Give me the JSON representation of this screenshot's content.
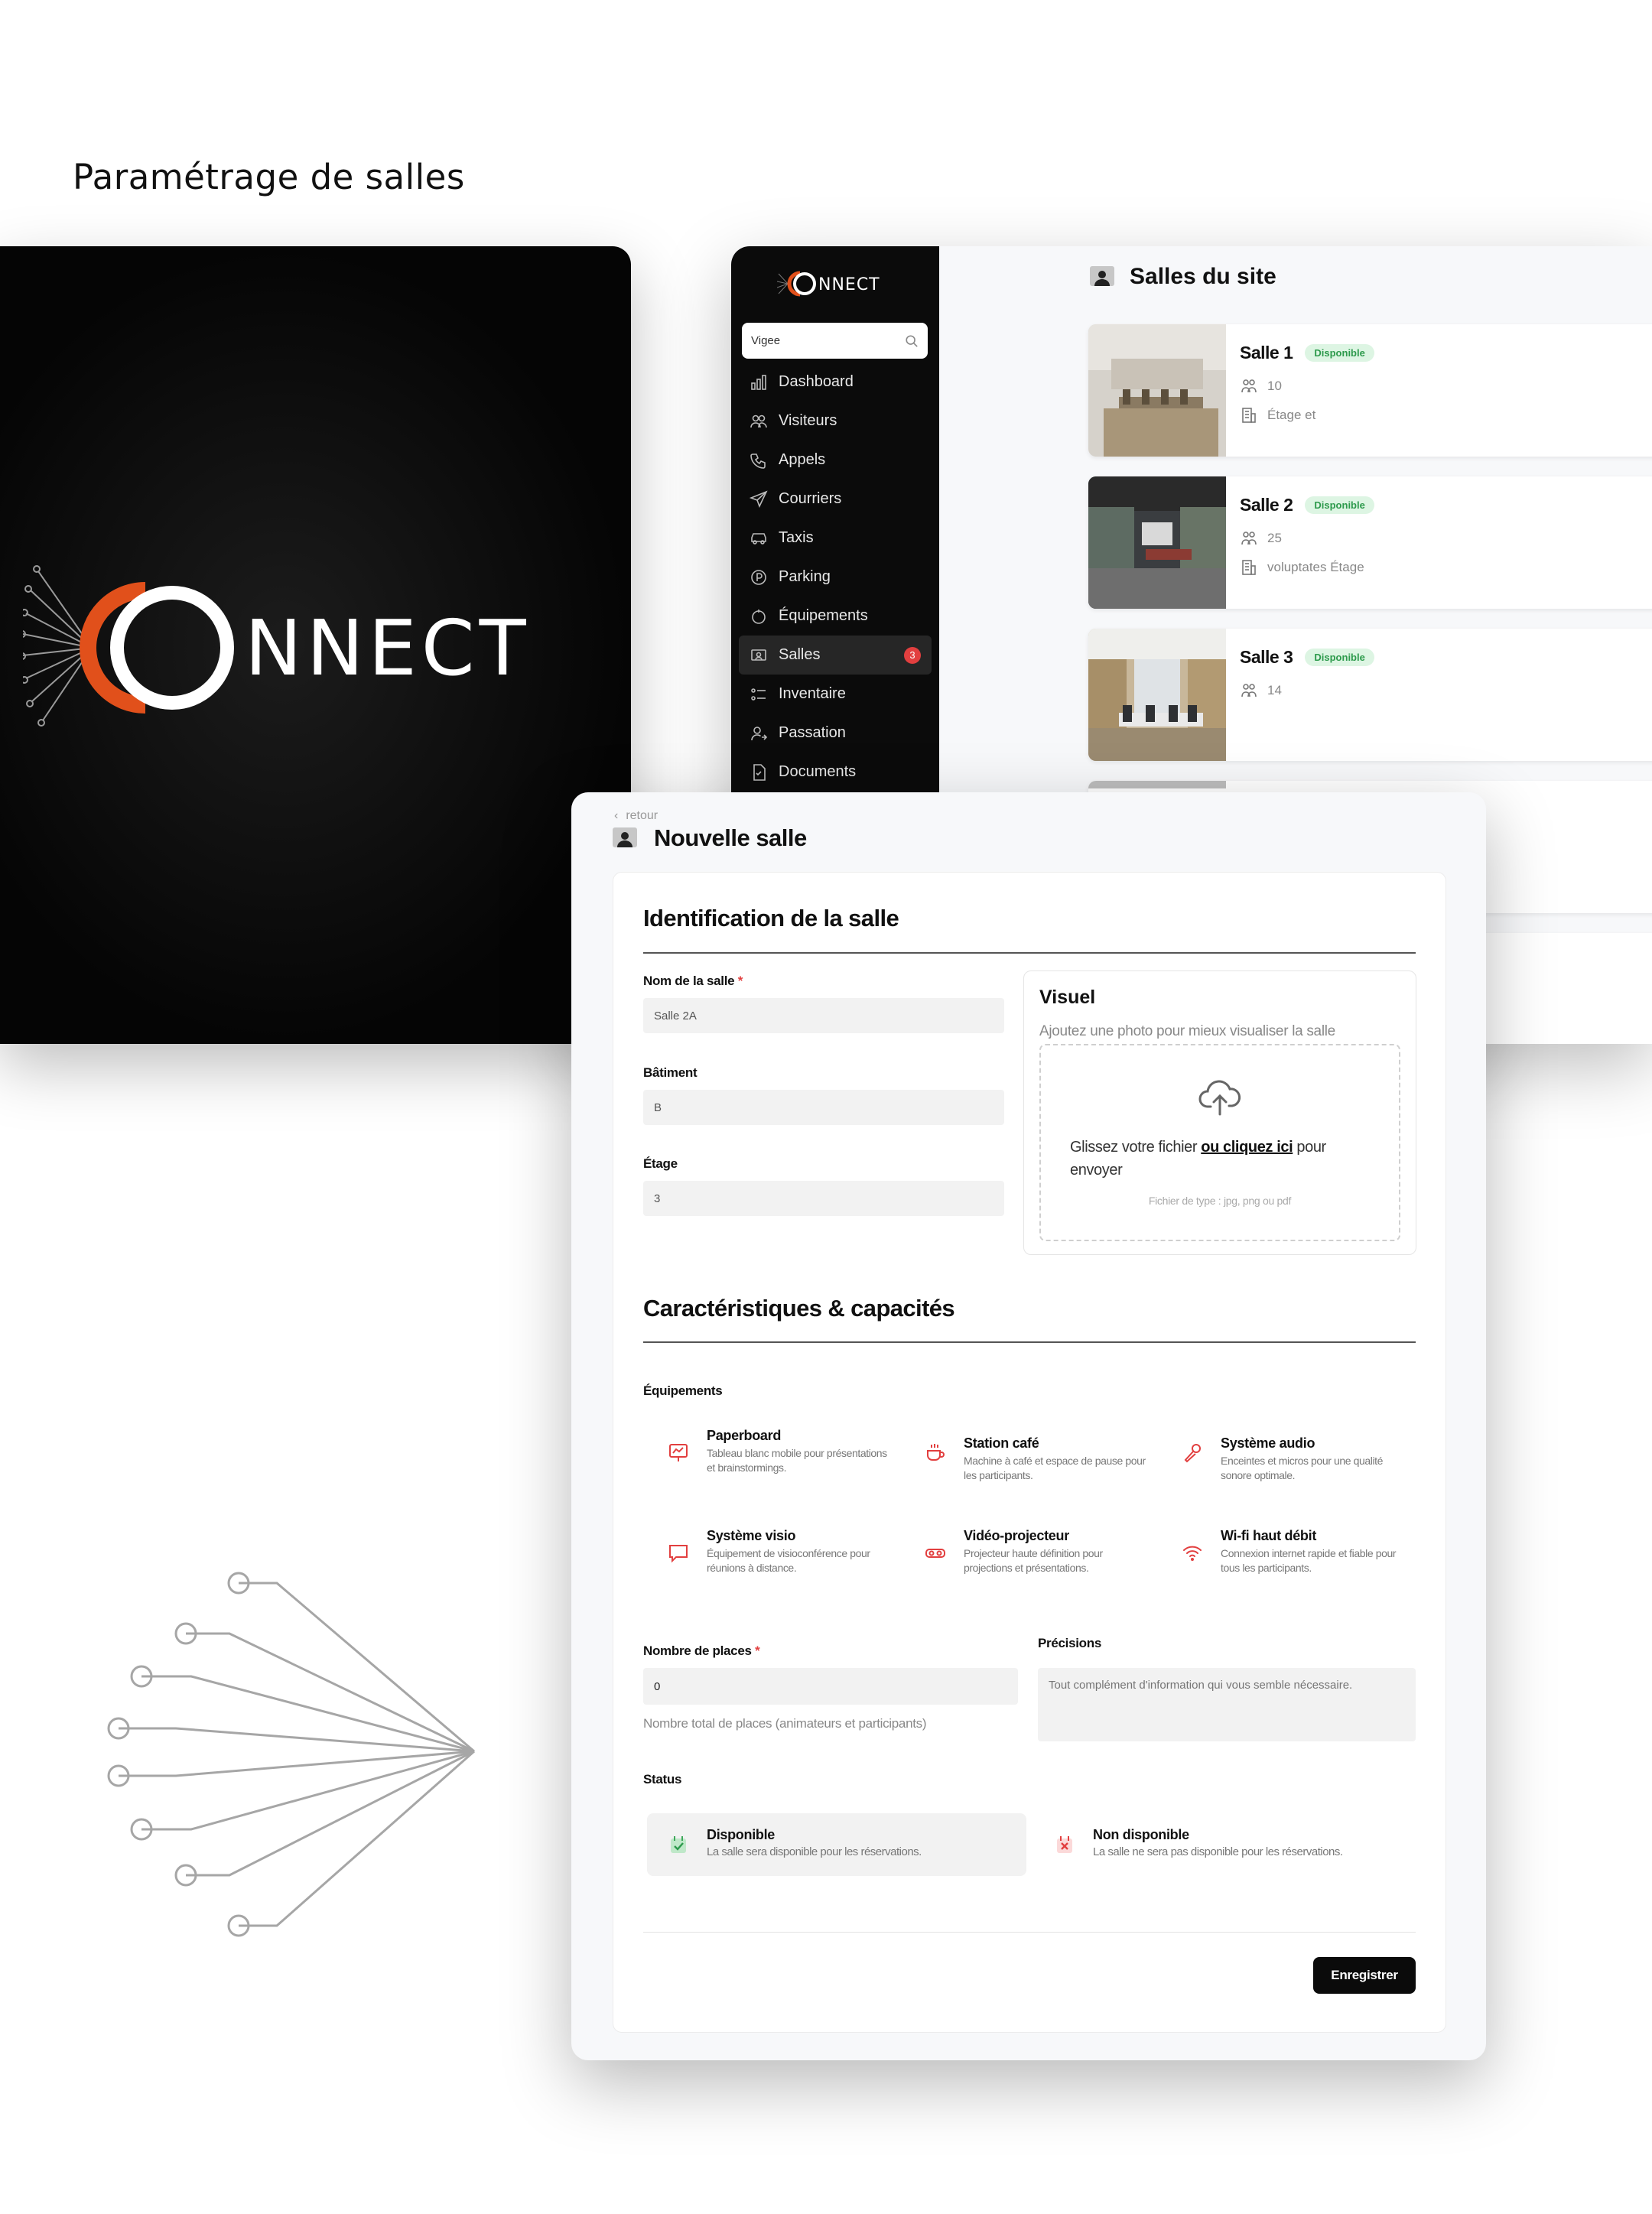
{
  "page": {
    "heading": "Paramétrage de salles"
  },
  "brand": {
    "logo_text": "NNECT",
    "accent": "#e1501b"
  },
  "sidebar": {
    "search": {
      "value": "Vigee"
    },
    "items": [
      {
        "label": "Dashboard",
        "icon": "chart-icon"
      },
      {
        "label": "Visiteurs",
        "icon": "users-icon"
      },
      {
        "label": "Appels",
        "icon": "phone-icon"
      },
      {
        "label": "Courriers",
        "icon": "send-icon"
      },
      {
        "label": "Taxis",
        "icon": "car-icon"
      },
      {
        "label": "Parking",
        "icon": "parking-icon"
      },
      {
        "label": "Équipements",
        "icon": "equipment-icon"
      },
      {
        "label": "Salles",
        "icon": "room-icon",
        "active": true,
        "badge": "3"
      },
      {
        "label": "Inventaire",
        "icon": "list-icon"
      },
      {
        "label": "Passation",
        "icon": "user-switch-icon"
      },
      {
        "label": "Documents",
        "icon": "document-icon"
      }
    ]
  },
  "salles": {
    "title": "Salles du site",
    "rooms": [
      {
        "name": "Salle 1",
        "status": "Disponible",
        "capacity": "10",
        "location": "Étage et"
      },
      {
        "name": "Salle 2",
        "status": "Disponible",
        "capacity": "25",
        "location": "voluptates Étage"
      },
      {
        "name": "Salle 3",
        "status": "Disponible",
        "capacity": "14",
        "location": ""
      }
    ]
  },
  "form": {
    "back": "retour",
    "title": "Nouvelle salle",
    "identification": {
      "title": "Identification de la salle",
      "name_label": "Nom de la salle",
      "name_value": "Salle 2A",
      "building_label": "Bâtiment",
      "building_value": "B",
      "floor_label": "Étage",
      "floor_value": "3"
    },
    "visual": {
      "title": "Visuel",
      "subtitle": "Ajoutez une photo pour mieux visualiser la salle",
      "drop_before": "Glissez votre fichier ",
      "drop_link": "ou cliquez ici",
      "drop_after": " pour envoyer",
      "hint": "Fichier de type : jpg, png ou pdf"
    },
    "characteristics": {
      "title": "Caractéristiques & capacités",
      "equipment_label": "Équipements",
      "equipments": [
        {
          "name": "Paperboard",
          "desc": "Tableau blanc mobile pour présentations et brainstormings."
        },
        {
          "name": "Station café",
          "desc": "Machine à café et espace de pause pour les participants."
        },
        {
          "name": "Système audio",
          "desc": "Enceintes et micros pour une qualité sonore optimale."
        },
        {
          "name": "Système visio",
          "desc": "Équipement de visioconférence pour réunions à distance."
        },
        {
          "name": "Vidéo-projecteur",
          "desc": "Projecteur haute définition pour projections et présentations."
        },
        {
          "name": "Wi-fi haut débit",
          "desc": "Connexion internet rapide et fiable pour tous les participants."
        }
      ],
      "places_label": "Nombre de places",
      "places_value": "0",
      "places_help": "Nombre total de places (animateurs et participants)",
      "precisions_label": "Précisions",
      "precisions_placeholder": "Tout complément d'information qui vous semble nécessaire."
    },
    "status": {
      "label": "Status",
      "options": [
        {
          "name": "Disponible",
          "desc": "La salle sera disponible pour les réservations.",
          "selected": true
        },
        {
          "name": "Non disponible",
          "desc": "La salle ne sera pas disponible pour les réservations.",
          "selected": false
        }
      ]
    },
    "save_label": "Enregistrer"
  },
  "colors": {
    "accent_red": "#e23f3f",
    "available_bg": "#ddf5e3",
    "available_text": "#2d9a4c",
    "dark": "#0b0b0b"
  }
}
